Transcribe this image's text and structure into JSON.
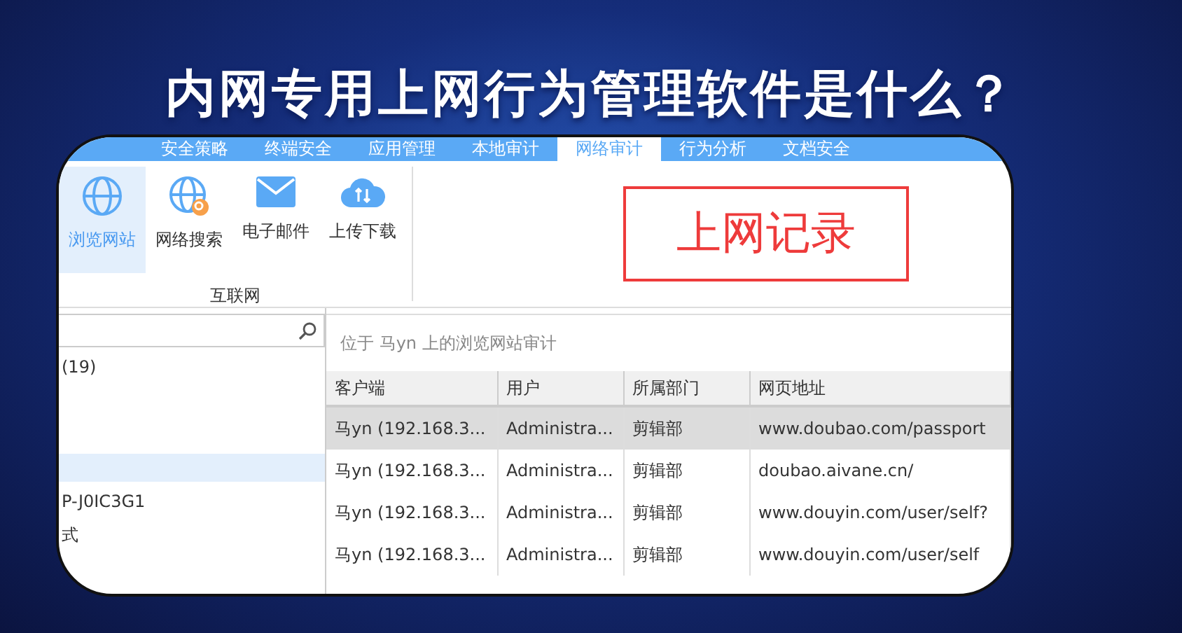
{
  "headline": "内网专用上网行为管理软件是什么？",
  "tabs": [
    {
      "label": "安全策略",
      "selected": false
    },
    {
      "label": "终端安全",
      "selected": false
    },
    {
      "label": "应用管理",
      "selected": false
    },
    {
      "label": "本地审计",
      "selected": false
    },
    {
      "label": "网络审计",
      "selected": true
    },
    {
      "label": "行为分析",
      "selected": false
    },
    {
      "label": "文档安全",
      "selected": false
    }
  ],
  "toolbar": {
    "group_label": "互联网",
    "items": [
      {
        "label": "浏览网站",
        "kind": "globe",
        "selected": true
      },
      {
        "label": "网络搜索",
        "kind": "search-globe",
        "selected": false
      },
      {
        "label": "电子邮件",
        "kind": "mail",
        "selected": false
      },
      {
        "label": "上传下载",
        "kind": "cloud",
        "selected": false
      }
    ]
  },
  "tree": {
    "items": [
      {
        "label": "(19)",
        "selected": false
      },
      {
        "selected": false
      },
      {
        "selected": false
      },
      {
        "selected": true
      },
      {
        "label": "P-J0IC3G1",
        "selected": false
      },
      {
        "label": "式",
        "selected": false
      }
    ]
  },
  "breadcrumb": "位于 马yn 上的浏览网站审计",
  "table": {
    "columns": [
      "客户端",
      "用户",
      "所属部门",
      "网页地址"
    ],
    "rows": [
      {
        "cells": [
          "马yn (192.168.3...",
          "Administra...",
          "剪辑部",
          "www.doubao.com/passport"
        ],
        "selected": true
      },
      {
        "cells": [
          "马yn (192.168.3...",
          "Administra...",
          "剪辑部",
          "doubao.aivane.cn/"
        ],
        "selected": false
      },
      {
        "cells": [
          "马yn (192.168.3...",
          "Administra...",
          "剪辑部",
          "www.douyin.com/user/self?"
        ],
        "selected": false
      },
      {
        "cells": [
          "马yn (192.168.3...",
          "Administra...",
          "剪辑部",
          "www.douyin.com/user/self"
        ],
        "selected": false
      }
    ]
  },
  "annotation": "上网记录"
}
